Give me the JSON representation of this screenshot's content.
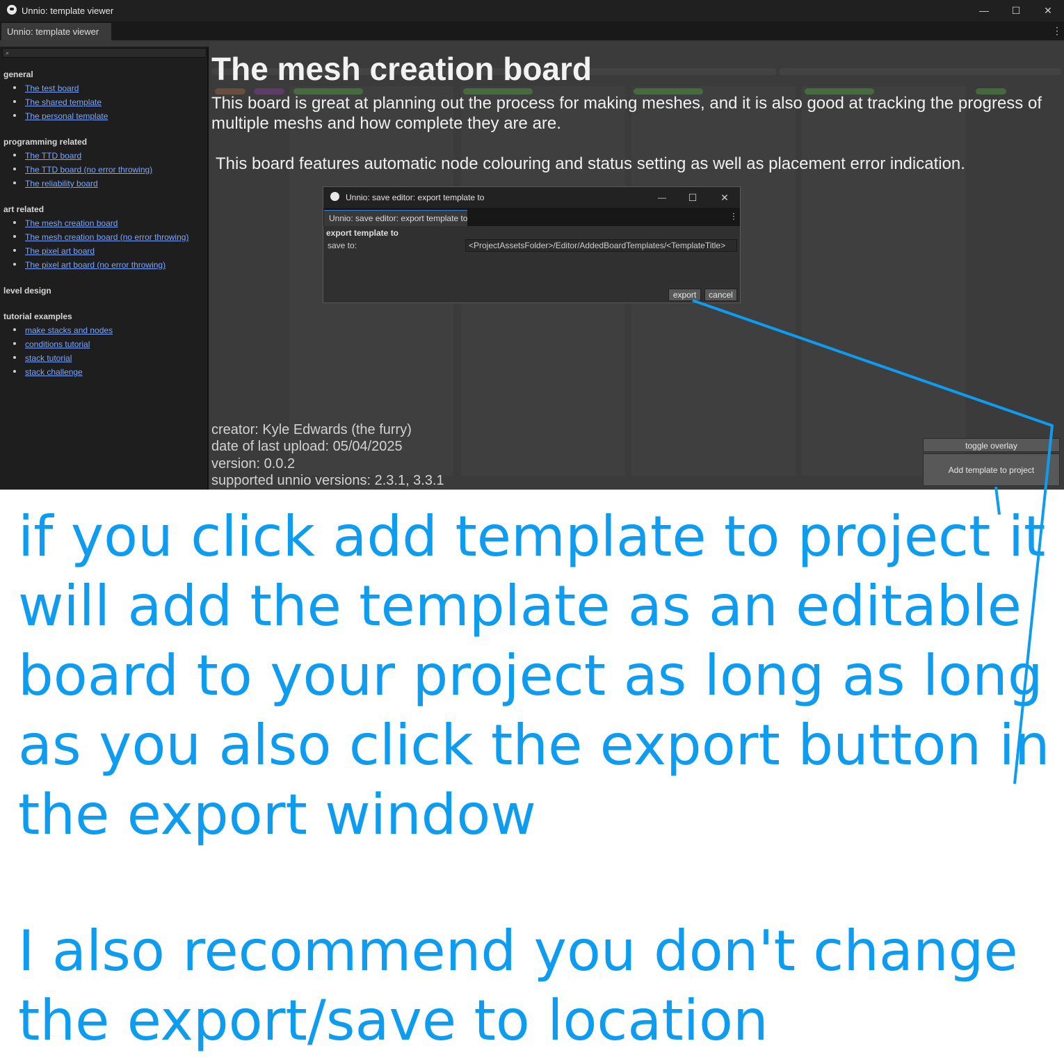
{
  "window": {
    "title": "Unnio: template viewer",
    "tab_label": "Unnio: template viewer",
    "controls": {
      "minimize": "—",
      "maximize": "☐",
      "close": "✕"
    },
    "menu": "⋮"
  },
  "sidebar": {
    "search_icon": "magnifier-icon",
    "categories": [
      {
        "label": "general",
        "items": [
          "The test board",
          "The shared template",
          "The personal template"
        ]
      },
      {
        "label": "programming related",
        "items": [
          "The TTD board",
          "The TTD board (no error throwing)",
          "The reliability board"
        ]
      },
      {
        "label": "art related",
        "items": [
          "The mesh creation board",
          "The mesh creation board (no error throwing)",
          "The pixel art board",
          "The pixel art board (no error throwing)"
        ]
      },
      {
        "label": "level design",
        "items": []
      },
      {
        "label": "tutorial examples",
        "items": [
          "make stacks and nodes",
          "conditions tutorial",
          "stack tutorial",
          "stack challenge"
        ]
      }
    ]
  },
  "overlay": {
    "title": "The mesh creation board",
    "description_1": "This board is great at planning out the process for making meshes, and it is also good at tracking the progress of multiple meshs and how complete they are are.",
    "description_2": "This board features automatic node colouring and status setting as well as placement error indication.",
    "creator": "creator: Kyle Edwards (the furry)",
    "last_upload": "date of last upload: 05/04/2025",
    "version": "version: 0.0.2",
    "supported": "supported unnio versions: 2.3.1, 3.3.1",
    "toggle_overlay": "toggle overlay",
    "add_template": "Add template to project"
  },
  "dialog": {
    "title": "Unnio: save editor: export template to",
    "tab_label": "Unnio: save editor: export template to",
    "heading": "export template to",
    "save_to_label": "save to:",
    "save_to_value": "<ProjectAssetsFolder>/Editor/AddedBoardTemplates/<TemplateTitle>",
    "export_label": "export",
    "cancel_label": "cancel",
    "controls": {
      "minimize": "—",
      "maximize": "☐",
      "close": "✕"
    },
    "menu": "⋮"
  },
  "annotation": {
    "main": "if you click add template to project it will add the template as an editable board to your project as long as long as you also click the export button in the export window",
    "secondary": "I also recommend you don't change the export/save to location"
  },
  "colors": {
    "annotation": "#0d9cf0",
    "link": "#7aa6ff",
    "window_bg": "#383838"
  }
}
